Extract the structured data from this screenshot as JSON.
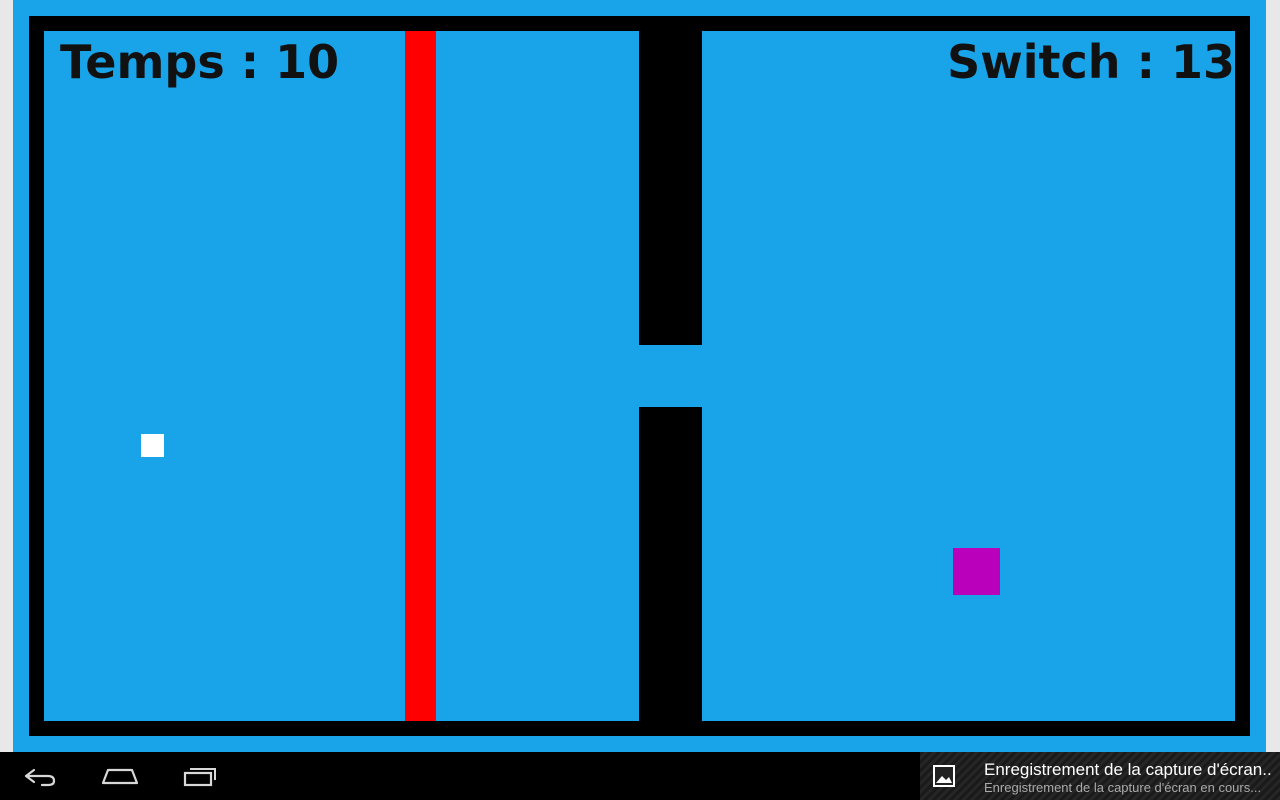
{
  "hud": {
    "time_text": "Temps : 10",
    "switch_text": "Switch : 13"
  },
  "game": {
    "colors": {
      "background": "#19a3e8",
      "wall": "#000000",
      "laser": "#ff0000",
      "player": "#ffffff",
      "target": "#bb00bb"
    }
  },
  "navbar": {
    "back_icon": "back-icon",
    "home_icon": "home-icon",
    "recent_icon": "recent-apps-icon"
  },
  "notification": {
    "icon": "image-icon",
    "title": "Enregistrement de la capture d'écran..",
    "subtitle": "Enregistrement de la capture d'écran en cours..."
  }
}
